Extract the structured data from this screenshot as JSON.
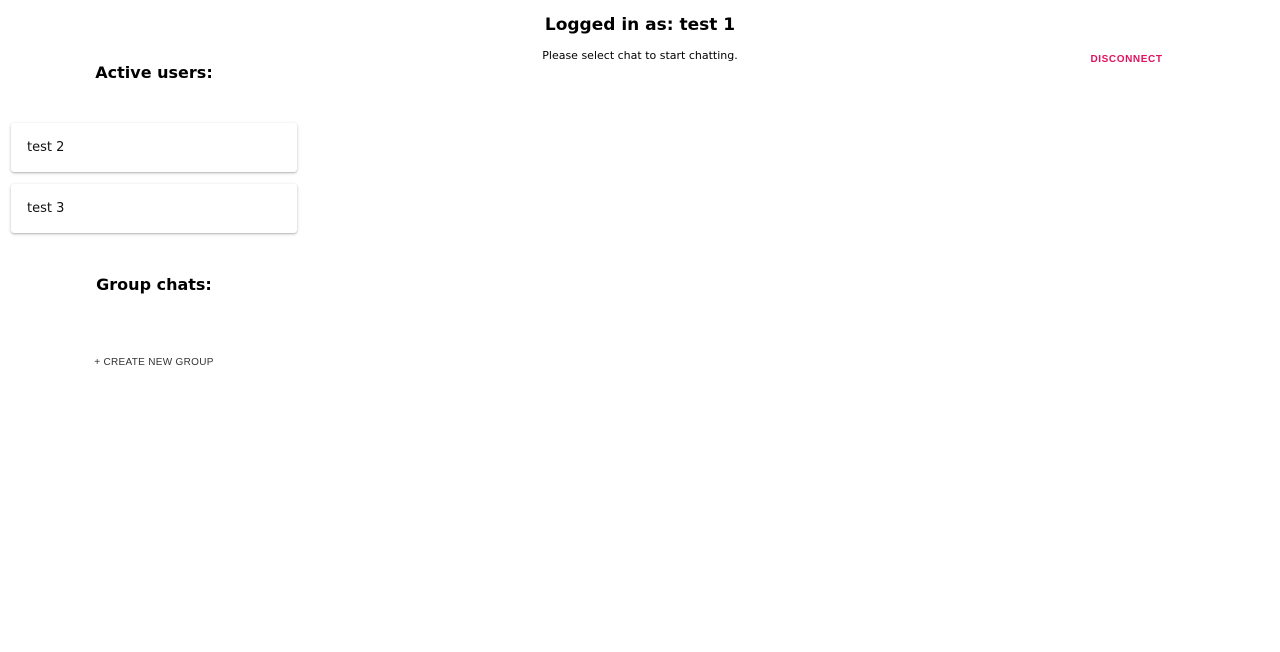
{
  "header": {
    "title": "Logged in as: test 1",
    "subtitle": "Please select chat to start chatting."
  },
  "actions": {
    "disconnect_label": "DISCONNECT",
    "create_group_label": "+ CREATE NEW GROUP"
  },
  "sidebar": {
    "active_users_heading": "Active users:",
    "group_chats_heading": "Group chats:",
    "users": [
      {
        "name": "test 2"
      },
      {
        "name": "test 3"
      }
    ],
    "groups": []
  },
  "colors": {
    "accent": "#e0115f"
  }
}
